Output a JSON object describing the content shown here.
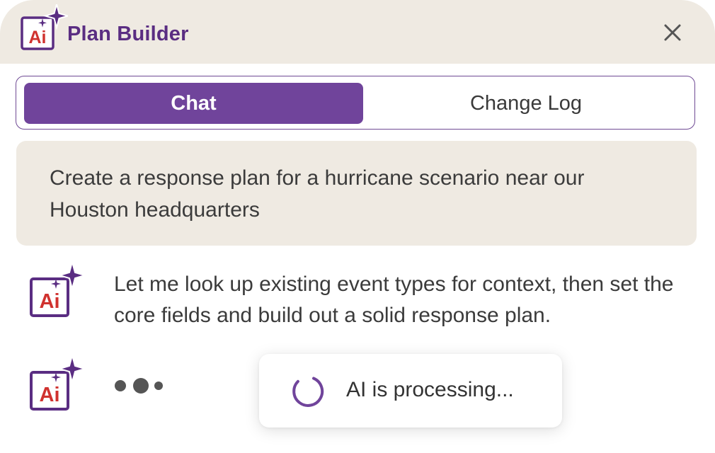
{
  "header": {
    "title": "Plan Builder",
    "logo_text": "Ai",
    "close_icon": "close-icon"
  },
  "tabs": [
    {
      "label": "Chat",
      "active": true
    },
    {
      "label": "Change Log",
      "active": false
    }
  ],
  "messages": {
    "user": "Create a response plan for a hurricane scenario near our Houston headquarters",
    "assistant": "Let me look up existing event types for context, then set the core fields and build out a solid response plan."
  },
  "status": {
    "processing_text": "AI is processing..."
  },
  "colors": {
    "brand_purple": "#70449B",
    "title_purple": "#5A2D82",
    "logo_red": "#D0322F",
    "header_bg": "#EFEAE2",
    "bubble_bg": "#EFEAE2"
  }
}
